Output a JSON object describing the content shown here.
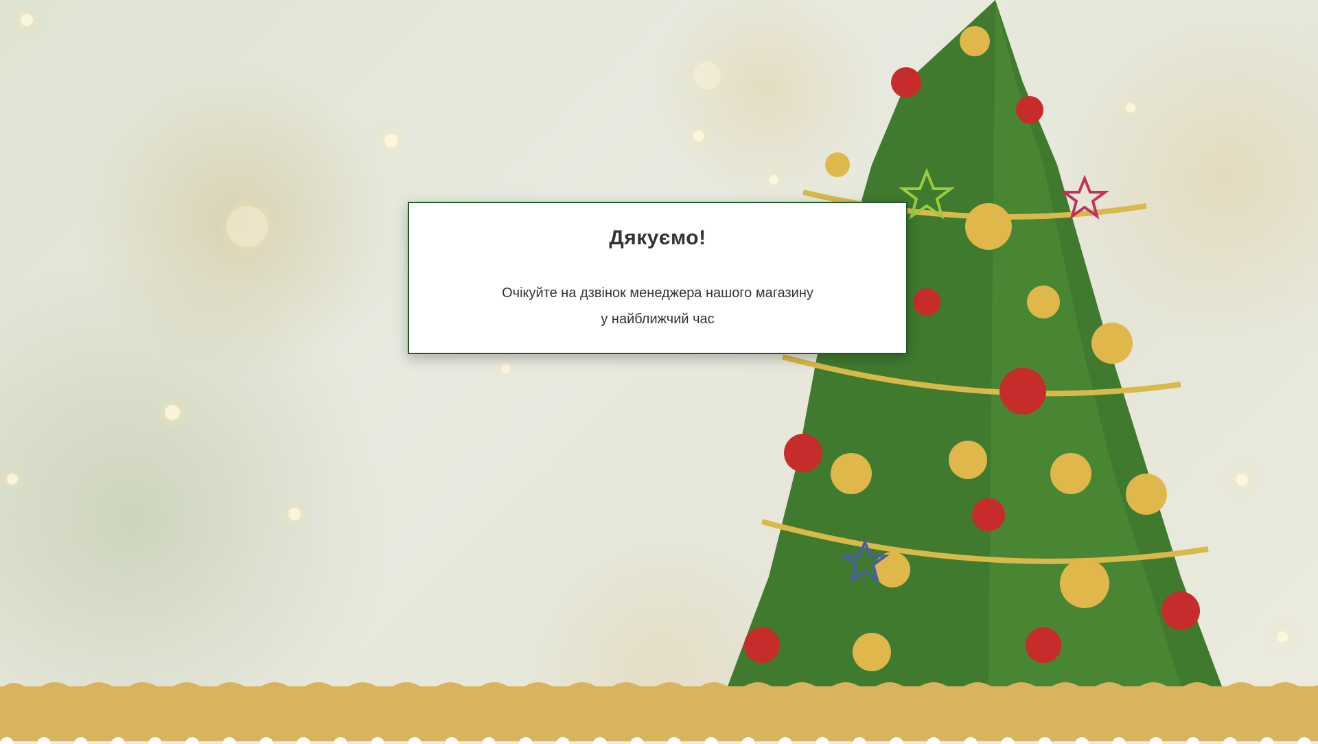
{
  "modal": {
    "title": "Дякуємо!",
    "message_line1": "Очікуйте на дзвінок менеджера нашого магазину",
    "message_line2": "у найближчий час",
    "border_color": "#1e5a2a"
  },
  "background": {
    "theme": "christmas-tree-bokeh"
  },
  "footer": {
    "color": "#d9b45f"
  }
}
